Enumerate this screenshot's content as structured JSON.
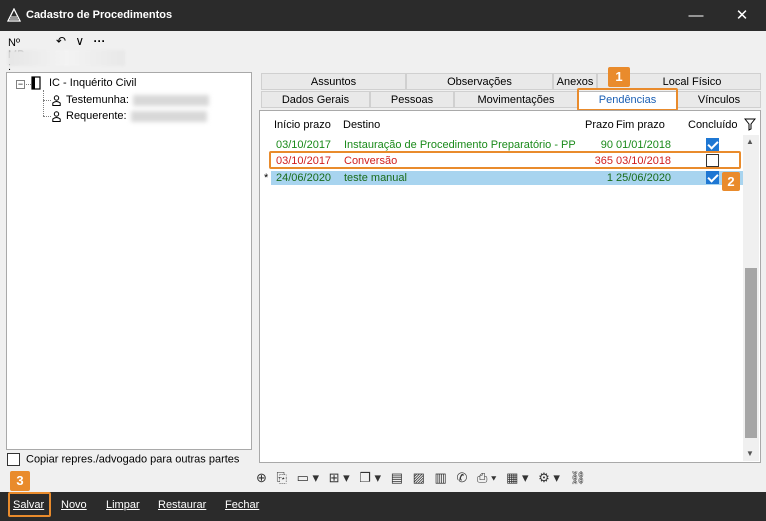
{
  "window": {
    "title": "Cadastro de Procedimentos",
    "minimize_symbol": "—",
    "close_symbol": "✕"
  },
  "mp": {
    "label": "Nº MP :",
    "back_symbol": "↶",
    "dropdown_symbol": "∨",
    "more_symbol": "···"
  },
  "tree": {
    "root_label": "IC - Inquérito Civil",
    "expander_symbol": "−",
    "children": [
      {
        "label": "Testemunha:"
      },
      {
        "label": "Requerente:"
      }
    ]
  },
  "copy_option": {
    "label": "Copiar repres./advogado para outras partes"
  },
  "tabs": {
    "row1": [
      "Assuntos",
      "Observações",
      "Anexos",
      "Local Físico"
    ],
    "row2": [
      "Dados Gerais",
      "Pessoas",
      "Movimentações",
      "Pendências",
      "Vínculos"
    ],
    "active": "Pendências"
  },
  "grid": {
    "columns": [
      "Início prazo",
      "Destino",
      "Prazo",
      "Fim prazo",
      "Concluído"
    ],
    "filter_icon": "filter-icon",
    "rows": [
      {
        "inicio": "03/10/2017",
        "destino": "Instauração de Procedimento Preparatório - PP",
        "prazo": "90",
        "fim": "01/01/2018",
        "concluido": true,
        "color": "#1a8a1a"
      },
      {
        "inicio": "03/10/2017",
        "destino": "Conversão",
        "prazo": "365",
        "fim": "03/10/2018",
        "concluido": false,
        "color": "#d01e1e"
      },
      {
        "marker": "*",
        "inicio": "24/06/2020",
        "destino": "teste manual",
        "prazo": "1",
        "fim": "25/06/2020",
        "concluido": true,
        "color": "#1a8a1a",
        "selected": true
      }
    ],
    "scroll_up": "▲",
    "scroll_down": "▼"
  },
  "toolbar": {
    "icons": [
      "add-page-icon",
      "copy-page-icon",
      "folder-icon",
      "tree-icon",
      "documents-icon",
      "clipboard-icon",
      "folder-image-icon",
      "attachment-icon",
      "phone-icon",
      "print-icon",
      "calendar-icon",
      "properties-icon",
      "link-icon"
    ],
    "glyphs": [
      "⊕",
      "⎘",
      "▭ ▾",
      "⊞ ▾",
      "❐ ▾",
      "▤",
      "▨",
      "▥",
      "✆",
      "⎙ ▾",
      "▦ ▾",
      "⚙ ▾",
      "⛓"
    ]
  },
  "bottom": {
    "buttons": [
      "Salvar",
      "Novo",
      "Limpar",
      "Restaurar",
      "Fechar"
    ]
  },
  "callouts": [
    "1",
    "2",
    "3"
  ],
  "colors": {
    "accent": "#e98b2c",
    "titlebar": "#2b2b2b",
    "selection": "#a8d4ef",
    "check_blue": "#1e77d3",
    "green": "#1a8a1a",
    "red": "#d01e1e"
  }
}
